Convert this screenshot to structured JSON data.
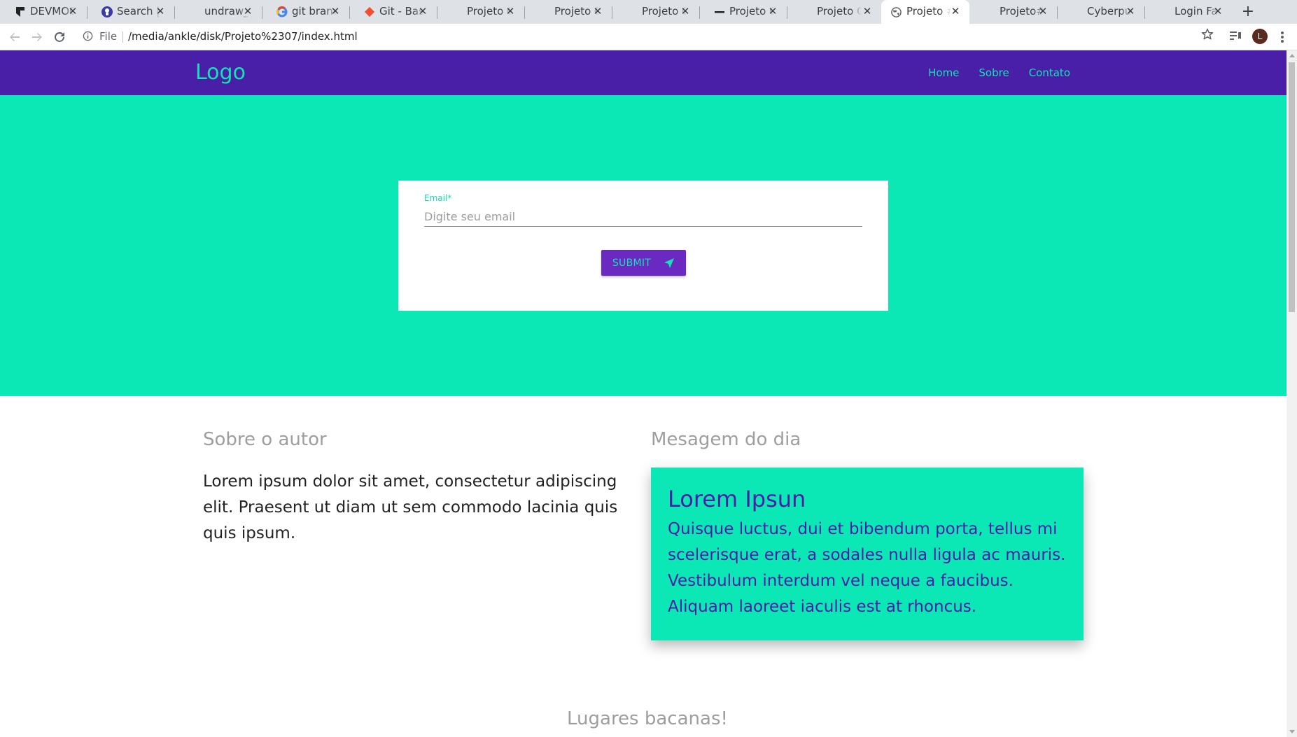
{
  "browser": {
    "tabs": [
      {
        "title": "DEVMOC",
        "icon": "devmoc-icon"
      },
      {
        "title": "Search | u",
        "icon": "search-site-icon"
      },
      {
        "title": "undraw_",
        "icon": "undraw-icon"
      },
      {
        "title": "git branc",
        "icon": "google-icon"
      },
      {
        "title": "Git - Basi",
        "icon": "git-icon"
      },
      {
        "title": "Projeto C",
        "icon": "page-icon"
      },
      {
        "title": "Projeto C",
        "icon": "page-icon"
      },
      {
        "title": "Projeto C",
        "icon": "page-icon"
      },
      {
        "title": "Projeto C",
        "icon": "dash-icon"
      },
      {
        "title": "Projeto C",
        "icon": "page-icon"
      },
      {
        "title": "Projeto #",
        "icon": "globe-icon",
        "active": true
      },
      {
        "title": "Projeto#",
        "icon": "page-icon"
      },
      {
        "title": "Cyberpu",
        "icon": "page-icon"
      },
      {
        "title": "Login Fa",
        "icon": "page-icon"
      }
    ],
    "scheme_label": "File",
    "url": "/media/ankle/disk/Projeto%2307/index.html",
    "profile_initial": "L"
  },
  "site": {
    "logo": "Logo",
    "nav": [
      "Home",
      "Sobre",
      "Contato"
    ],
    "form": {
      "email_label": "Email*",
      "email_placeholder": "Digite seu email",
      "submit_label": "SUBMIT"
    },
    "about": {
      "title": "Sobre o autor",
      "text": "Lorem ipsum dolor sit amet, consectetur adipiscing elit. Praesent ut diam ut sem commodo lacinia quis quis ipsum."
    },
    "message": {
      "title": "Mesagem do dia",
      "card_title": "Lorem Ipsun",
      "card_body": "Quisque luctus, dui et bibendum porta, tellus mi scelerisque erat, a sodales nulla ligula ac mauris. Vestibulum interdum vel neque a faucibus. Aliquam laoreet iaculis est at rhoncus."
    },
    "places_title": "Lugares bacanas!"
  },
  "colors": {
    "nav_bg": "#4a1fa8",
    "accent": "#0ce7b6",
    "button_bg": "#6a29c0"
  }
}
